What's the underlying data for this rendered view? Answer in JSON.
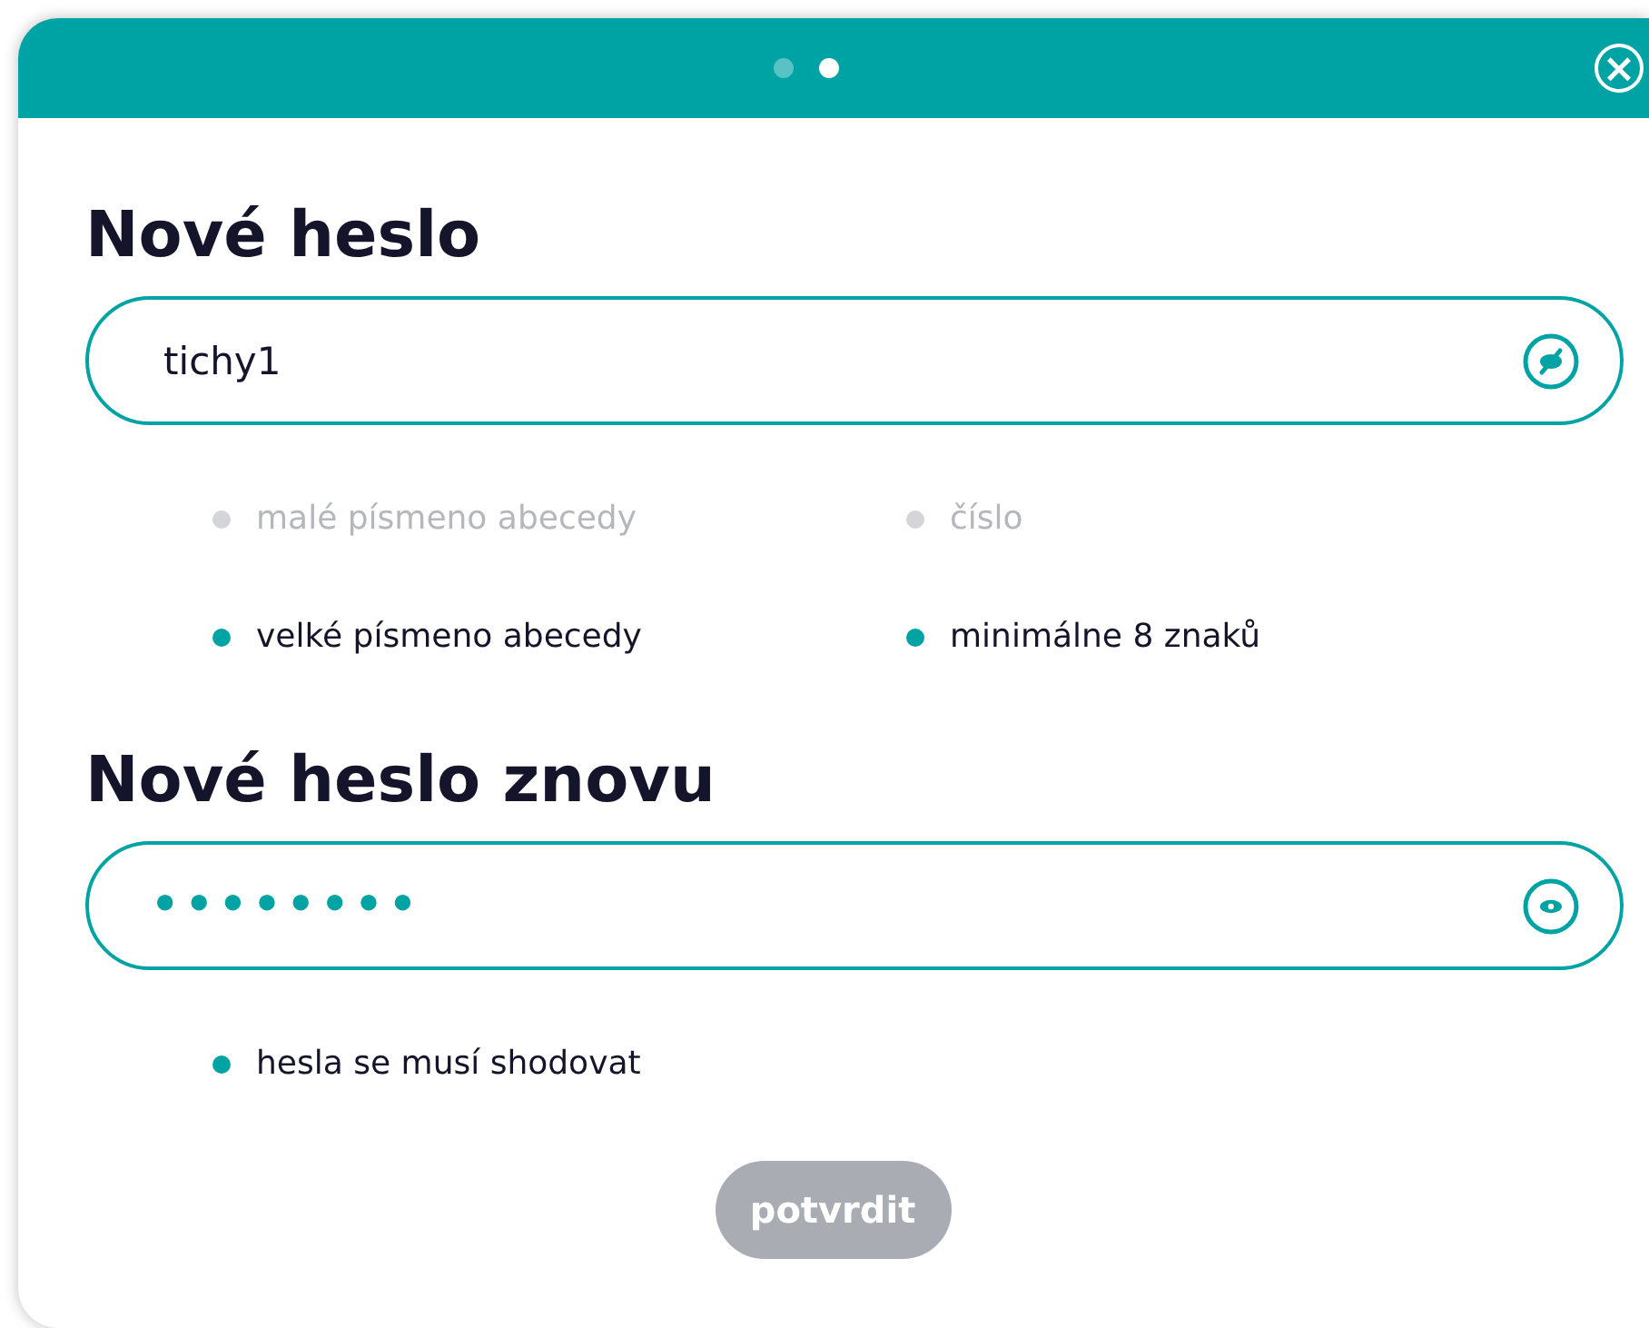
{
  "pager": [
    {
      "selected": false
    },
    {
      "selected": true
    }
  ],
  "close": "×",
  "sections": [
    {
      "title": "Nové heslo",
      "field": {
        "value": "tichy1",
        "visible": true
      },
      "rules": [
        {
          "label": "malé písmeno abecedy",
          "met": false
        },
        {
          "label": "číslo",
          "met": false
        },
        {
          "label": "velké písmeno abecedy",
          "met": true
        },
        {
          "label": "minimálne 8 znaků",
          "met": true
        }
      ]
    },
    {
      "title": "Nové heslo znovu",
      "field": {
        "value": "••••••••",
        "visible": false
      },
      "rules": [
        {
          "label": "hesla se musí shodovat",
          "met": true
        }
      ]
    }
  ],
  "button": {
    "label": "potvrdit",
    "disabled": true
  }
}
